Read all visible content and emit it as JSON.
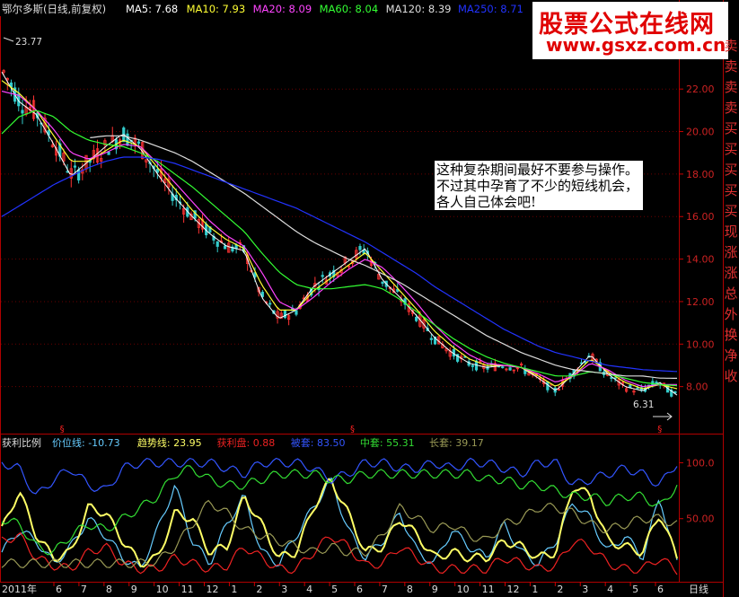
{
  "header": {
    "stock": "鄂尔多斯(日线,前复权)",
    "ma": [
      {
        "label": "MA5: 7.68",
        "color": "#ffffff"
      },
      {
        "label": "MA10: 7.93",
        "color": "#ffff33"
      },
      {
        "label": "MA20: 8.09",
        "color": "#ff44ff"
      },
      {
        "label": "MA60: 8.04",
        "color": "#33ff33"
      },
      {
        "label": "MA120: 8.39",
        "color": "#dddddd"
      },
      {
        "label": "MA250: 8.71",
        "color": "#2233ff"
      }
    ]
  },
  "watermark": {
    "title": "股票公式在线网",
    "url": "www.gsxz.com.cn"
  },
  "note": "这种复杂期间最好不要参与操作。不过其中孕育了不少的短线机会，各人自己体会吧!",
  "price_markers": {
    "high": "23.77",
    "low": "6.31"
  },
  "indicator": {
    "name": "获利比例",
    "items": [
      {
        "label": "价位线: -10.73",
        "color": "#66ccff"
      },
      {
        "label": "趋势线: 23.95",
        "color": "#ffff66"
      },
      {
        "label": "获利盘: 0.88",
        "color": "#ee2222"
      },
      {
        "label": "被套: 83.50",
        "color": "#3355ff"
      },
      {
        "label": "中套: 55.31",
        "color": "#33dd33"
      },
      {
        "label": "长套: 39.17",
        "color": "#999955"
      }
    ]
  },
  "side_labels": [
    "卖",
    "卖",
    "卖",
    "卖",
    "买",
    "买",
    "买",
    "买",
    "买",
    "现",
    "涨",
    "涨",
    "总",
    "外",
    "换",
    "净",
    "收"
  ],
  "bottom": {
    "year": "2011年",
    "period": "日线",
    "months": [
      "6",
      "7",
      "8",
      "9",
      "10",
      "11",
      "12",
      "1",
      "2",
      "3",
      "4",
      "5",
      "6",
      "7",
      "8",
      "9",
      "10",
      "11",
      "12",
      "1",
      "2",
      "3",
      "4",
      "5",
      "6"
    ]
  },
  "colors": {
    "up": "#ff3333",
    "down": "#33cccc",
    "axis": "#cc0000"
  },
  "chart_data": [
    {
      "type": "line",
      "title": "",
      "y_axis_ticks": [
        "8.00",
        "10.00",
        "12.00",
        "14.00",
        "16.00",
        "18.00",
        "20.00",
        "22.00"
      ],
      "ylim": [
        6.0,
        24.5
      ],
      "series": [
        {
          "name": "MA5",
          "color": "#ffffff",
          "values": [
            22.8,
            21.4,
            20.8,
            19.4,
            17.9,
            18.6,
            19.3,
            19.9,
            19.2,
            18.0,
            16.9,
            16.0,
            15.2,
            14.6,
            14.4,
            12.2,
            11.2,
            11.6,
            12.7,
            13.3,
            13.9,
            14.5,
            13.0,
            12.2,
            11.3,
            10.3,
            9.6,
            9.1,
            8.9,
            9.0,
            8.9,
            8.4,
            7.8,
            8.6,
            9.5,
            8.6,
            8.0,
            7.8,
            8.2,
            7.6
          ]
        },
        {
          "name": "MA10",
          "color": "#ffff33",
          "values": [
            22.4,
            21.8,
            21.0,
            19.8,
            18.6,
            18.6,
            19.1,
            19.6,
            19.3,
            18.3,
            17.3,
            16.3,
            15.5,
            14.9,
            14.5,
            12.8,
            11.6,
            11.6,
            12.5,
            13.1,
            13.7,
            14.3,
            13.4,
            12.5,
            11.6,
            10.6,
            9.9,
            9.3,
            9.0,
            9.0,
            8.9,
            8.5,
            8.0,
            8.5,
            9.3,
            8.7,
            8.2,
            7.9,
            8.1,
            7.9
          ]
        },
        {
          "name": "MA20",
          "color": "#ff44ff",
          "values": [
            21.9,
            21.7,
            21.0,
            20.1,
            19.0,
            18.7,
            19.0,
            19.4,
            19.3,
            18.5,
            17.6,
            16.7,
            15.8,
            15.1,
            14.6,
            13.4,
            12.0,
            11.6,
            12.2,
            12.9,
            13.5,
            14.0,
            13.6,
            12.8,
            11.9,
            10.9,
            10.1,
            9.5,
            9.1,
            9.0,
            8.9,
            8.6,
            8.2,
            8.5,
            9.1,
            8.8,
            8.3,
            8.0,
            8.1,
            8.1
          ]
        },
        {
          "name": "MA60",
          "color": "#33ff33",
          "values": [
            19.9,
            20.7,
            21.0,
            20.7,
            20.0,
            19.6,
            19.4,
            19.3,
            19.0,
            18.6,
            18.0,
            17.4,
            16.7,
            16.0,
            15.3,
            14.3,
            13.4,
            12.8,
            12.6,
            12.6,
            12.7,
            12.8,
            12.6,
            12.1,
            11.5,
            10.9,
            10.3,
            9.8,
            9.4,
            9.1,
            8.9,
            8.7,
            8.5,
            8.5,
            8.7,
            8.6,
            8.4,
            8.2,
            8.1,
            8.04
          ]
        },
        {
          "name": "MA120",
          "color": "#dddddd",
          "values": [
            null,
            null,
            null,
            null,
            null,
            19.7,
            19.8,
            19.8,
            19.6,
            19.3,
            19.0,
            18.6,
            18.1,
            17.6,
            17.1,
            16.5,
            15.9,
            15.3,
            14.8,
            14.4,
            14.0,
            13.7,
            13.3,
            12.9,
            12.4,
            11.9,
            11.4,
            10.9,
            10.4,
            10.0,
            9.6,
            9.3,
            9.0,
            8.8,
            8.7,
            8.6,
            8.5,
            8.5,
            8.4,
            8.39
          ]
        },
        {
          "name": "MA250",
          "color": "#2233ff",
          "values": [
            16.0,
            16.5,
            17.0,
            17.5,
            17.9,
            18.3,
            18.6,
            18.8,
            18.8,
            18.7,
            18.5,
            18.2,
            17.9,
            17.6,
            17.3,
            17.0,
            16.7,
            16.4,
            16.0,
            15.6,
            15.2,
            14.8,
            14.3,
            13.8,
            13.3,
            12.7,
            12.2,
            11.7,
            11.2,
            10.7,
            10.3,
            9.9,
            9.6,
            9.4,
            9.2,
            9.0,
            8.9,
            8.8,
            8.75,
            8.71
          ]
        }
      ]
    },
    {
      "type": "line",
      "title": "",
      "y_axis_ticks": [
        "50.00",
        "100.0"
      ],
      "ylim": [
        0,
        110
      ],
      "series": [
        {
          "name": "价位线",
          "color": "#66ccff",
          "values": [
            20,
            40,
            30,
            10,
            25,
            50,
            35,
            15,
            5,
            40,
            80,
            30,
            10,
            45,
            70,
            20,
            10,
            35,
            60,
            85,
            40,
            15,
            30,
            55,
            20,
            10,
            40,
            25,
            15,
            45,
            20,
            10,
            30,
            65,
            50,
            20,
            35,
            15,
            70,
            10
          ]
        },
        {
          "name": "趋势线",
          "color": "#ffff66",
          "values": [
            40,
            75,
            35,
            15,
            20,
            60,
            55,
            30,
            10,
            15,
            55,
            50,
            20,
            25,
            70,
            45,
            15,
            20,
            60,
            85,
            55,
            20,
            25,
            50,
            35,
            15,
            20,
            15,
            15,
            30,
            25,
            15,
            20,
            80,
            70,
            30,
            25,
            20,
            55,
            15
          ]
        },
        {
          "name": "获利盘",
          "color": "#ee2222",
          "values": [
            30,
            35,
            15,
            8,
            5,
            20,
            25,
            10,
            5,
            5,
            15,
            10,
            5,
            8,
            25,
            15,
            5,
            5,
            20,
            35,
            25,
            8,
            10,
            25,
            15,
            5,
            5,
            5,
            5,
            15,
            10,
            5,
            8,
            30,
            25,
            10,
            5,
            5,
            15,
            3
          ]
        },
        {
          "name": "被套",
          "color": "#3355ff",
          "values": [
            100,
            95,
            70,
            85,
            95,
            80,
            75,
            95,
            100,
            100,
            100,
            100,
            100,
            95,
            90,
            100,
            100,
            100,
            95,
            85,
            90,
            100,
            100,
            95,
            95,
            100,
            95,
            100,
            100,
            95,
            90,
            100,
            100,
            80,
            85,
            90,
            95,
            90,
            80,
            100
          ]
        },
        {
          "name": "中套",
          "color": "#33dd33",
          "values": [
            50,
            45,
            25,
            20,
            35,
            45,
            40,
            50,
            60,
            70,
            90,
            95,
            85,
            80,
            80,
            85,
            90,
            90,
            90,
            85,
            85,
            90,
            90,
            90,
            90,
            90,
            90,
            90,
            85,
            85,
            80,
            80,
            75,
            70,
            70,
            65,
            70,
            70,
            60,
            80
          ]
        },
        {
          "name": "长套",
          "color": "#999955",
          "values": [
            10,
            10,
            10,
            10,
            10,
            10,
            10,
            10,
            10,
            12,
            25,
            45,
            65,
            55,
            40,
            35,
            30,
            25,
            20,
            25,
            20,
            20,
            35,
            60,
            50,
            40,
            45,
            35,
            30,
            45,
            50,
            60,
            60,
            55,
            45,
            40,
            45,
            50,
            50,
            45
          ]
        }
      ]
    }
  ]
}
